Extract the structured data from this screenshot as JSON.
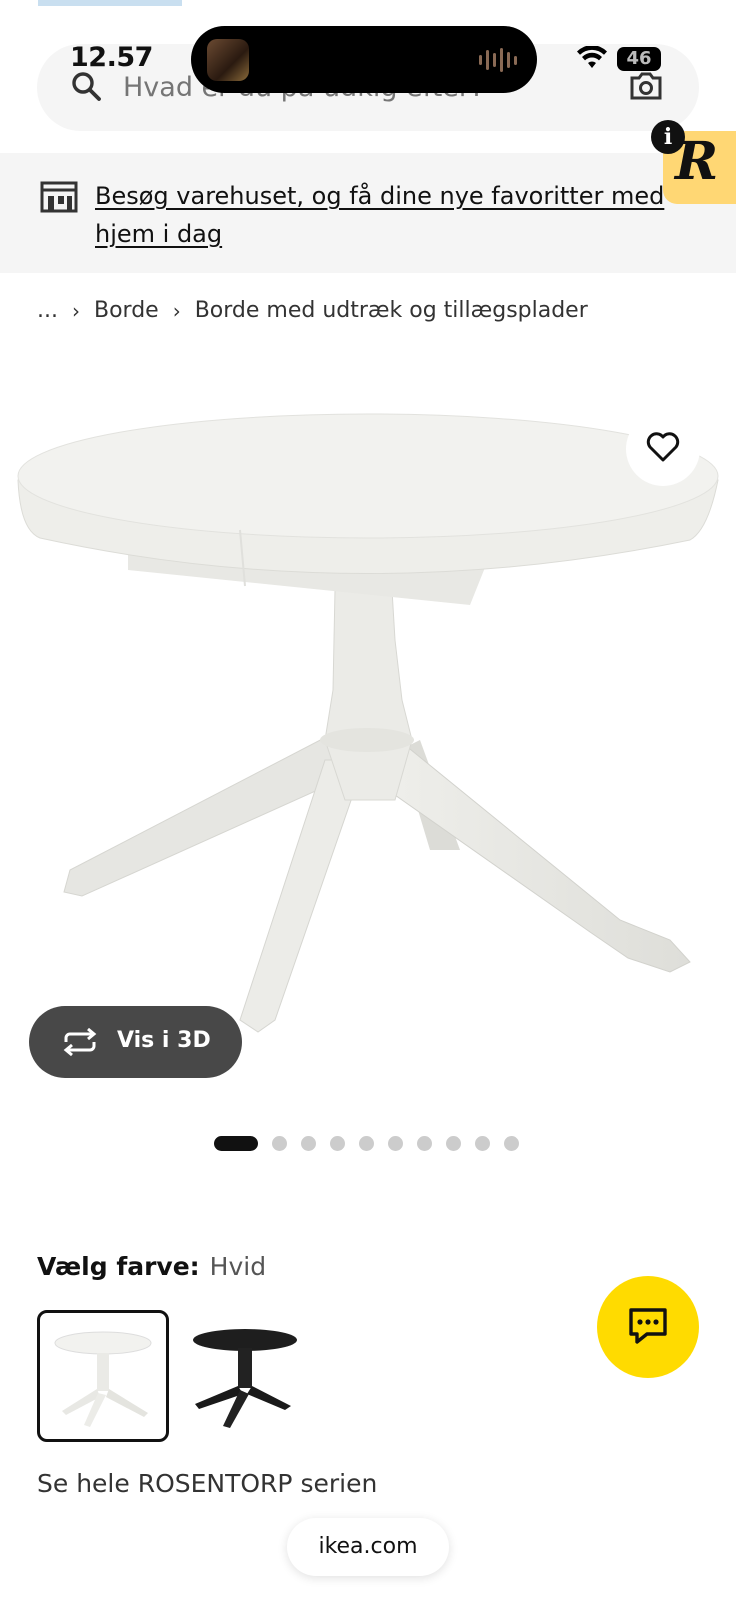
{
  "status_bar": {
    "time": "12.57",
    "battery": "46"
  },
  "search": {
    "placeholder": "Hvad er du på udkig efter?"
  },
  "banner": {
    "text": "Besøg varehuset, og få dine nye favoritter med hjem i dag",
    "info_label": "i",
    "extension_letter": "R"
  },
  "breadcrumb": {
    "ellipsis": "...",
    "items": [
      "Borde",
      "Borde med udtræk og tillægsplader"
    ]
  },
  "product": {
    "view_3d_label": "Vis i 3D",
    "image_count": 10,
    "active_image_index": 0
  },
  "color": {
    "label": "Vælg farve:",
    "value": "Hvid",
    "swatches": [
      {
        "name": "Hvid",
        "hex": "#f2f2ef",
        "selected": true
      },
      {
        "name": "Sort",
        "hex": "#1e1e1e",
        "selected": false
      }
    ]
  },
  "series_link": "Se hele ROSENTORP serien",
  "browser": {
    "url": "ikea.com"
  },
  "colors": {
    "chat_button": "#ffdb00",
    "banner_bg": "#f5f5f5",
    "extension_badge": "#ffd774"
  }
}
